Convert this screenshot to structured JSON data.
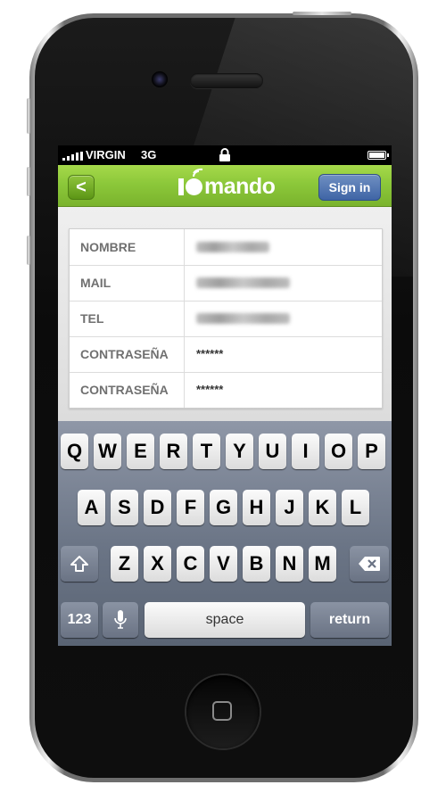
{
  "status_bar": {
    "carrier": "VIRGIN",
    "network": "3G",
    "lock_icon": "lock-icon",
    "battery_icon": "battery-icon"
  },
  "nav": {
    "back_label": "<",
    "logo_text": "mando",
    "signin_label": "Sign in"
  },
  "form": {
    "rows": [
      {
        "label": "NOMBRE",
        "value": "",
        "obscured": true
      },
      {
        "label": "MAIL",
        "value": "",
        "obscured": true
      },
      {
        "label": "TEL",
        "value": "",
        "obscured": true
      },
      {
        "label": "CONTRASEÑA",
        "value": "******",
        "obscured": false
      },
      {
        "label": "CONTRASEÑA",
        "value": "******",
        "obscured": false
      }
    ]
  },
  "keyboard": {
    "row1": [
      "Q",
      "W",
      "E",
      "R",
      "T",
      "Y",
      "U",
      "I",
      "O",
      "P"
    ],
    "row2": [
      "A",
      "S",
      "D",
      "F",
      "G",
      "H",
      "J",
      "K",
      "L"
    ],
    "row3": [
      "Z",
      "X",
      "C",
      "V",
      "B",
      "N",
      "M"
    ],
    "numbers_label": "123",
    "space_label": "space",
    "return_label": "return",
    "shift_icon": "shift-icon",
    "delete_icon": "delete-icon",
    "mic_icon": "microphone-icon"
  },
  "colors": {
    "nav_green": "#8cc83a",
    "signin_blue": "#4f73b0"
  }
}
